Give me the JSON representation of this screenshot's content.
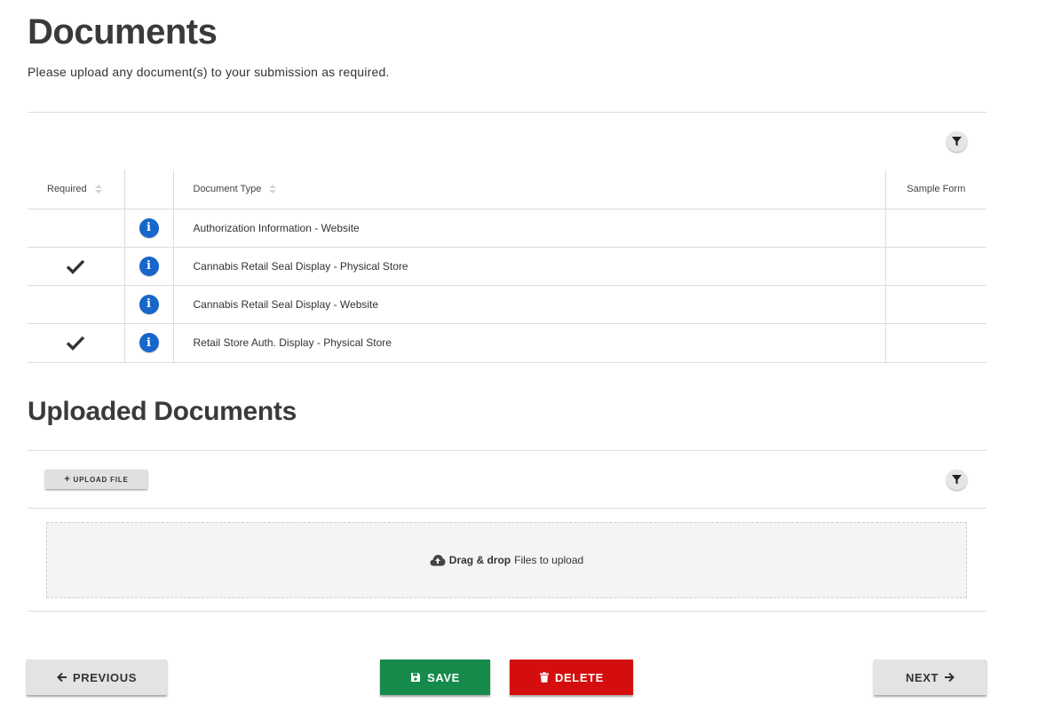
{
  "header": {
    "title": "Documents",
    "subtitle": "Please upload any document(s) to your submission as required."
  },
  "required_table": {
    "columns": {
      "required": "Required",
      "document_type": "Document Type",
      "sample_form": "Sample Form"
    },
    "rows": [
      {
        "required": false,
        "document_type": "Authorization Information - Website"
      },
      {
        "required": true,
        "document_type": "Cannabis Retail Seal Display - Physical Store"
      },
      {
        "required": false,
        "document_type": "Cannabis Retail Seal Display - Website"
      },
      {
        "required": true,
        "document_type": "Retail Store Auth. Display - Physical Store"
      }
    ]
  },
  "uploaded": {
    "title": "Uploaded Documents",
    "upload_label": "UPLOAD FILE",
    "dropzone_bold": "Drag & drop",
    "dropzone_text": "Files to upload"
  },
  "footer": {
    "previous": "PREVIOUS",
    "save": "SAVE",
    "delete": "DELETE",
    "next": "NEXT"
  },
  "colors": {
    "info_blue": "#1766c9",
    "save_green": "#158a4a",
    "delete_red": "#d40e0e"
  },
  "icons": [
    "filter-icon",
    "sort-icon",
    "info-icon",
    "checkmark-icon",
    "plus-icon",
    "cloud-upload-icon",
    "arrow-left-icon",
    "floppy-disk-icon",
    "trash-icon",
    "arrow-right-icon"
  ]
}
